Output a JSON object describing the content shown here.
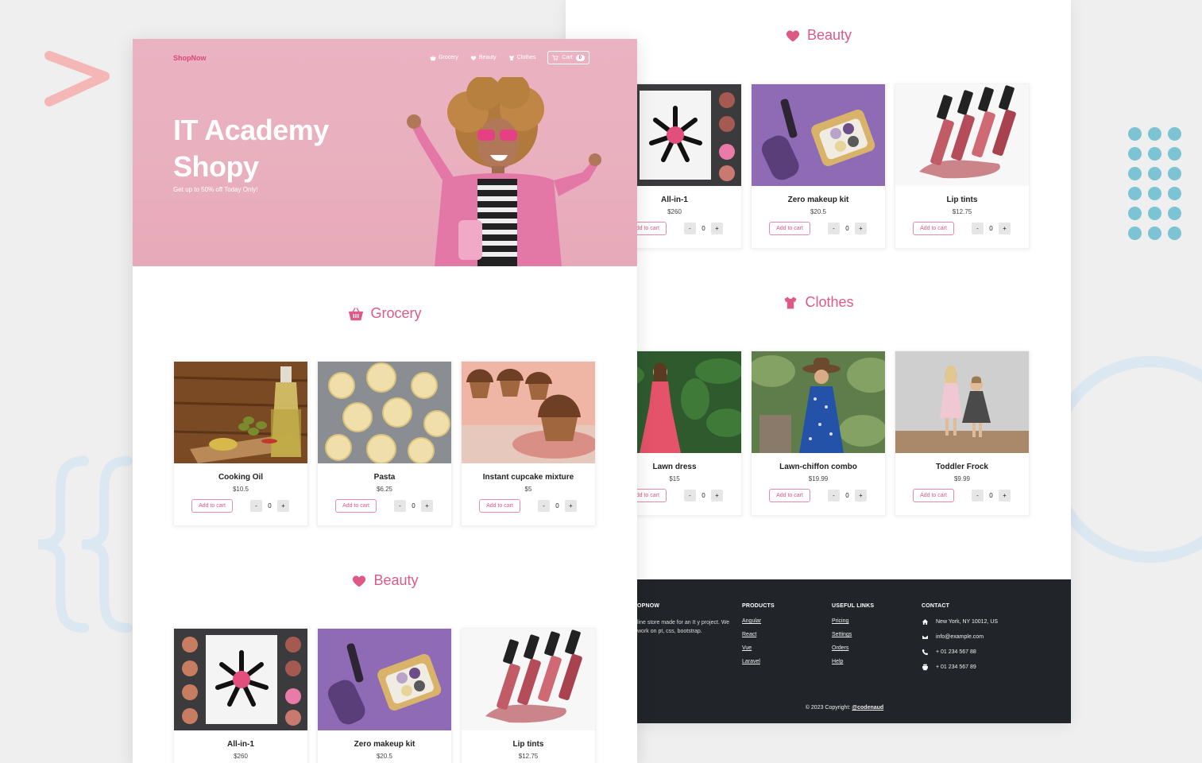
{
  "brand": "ShopNow",
  "nav": {
    "links": [
      {
        "label": "Grocery",
        "icon": "basket-icon"
      },
      {
        "label": "Beauty",
        "icon": "heart-icon"
      },
      {
        "label": "Clothes",
        "icon": "shirt-icon"
      }
    ],
    "cart_label": "Cart",
    "cart_count": "0"
  },
  "hero": {
    "title_line1": "IT Academy",
    "title_line2": "Shopy",
    "tagline": "Get up to 50% off Today Only!"
  },
  "add_to_cart_label": "Add to cart",
  "sections": {
    "grocery": {
      "title": "Grocery",
      "products": [
        {
          "name": "Cooking Oil",
          "price": "$10.5",
          "qty": "0"
        },
        {
          "name": "Pasta",
          "price": "$6.25",
          "qty": "0"
        },
        {
          "name": "Instant cupcake mixture",
          "price": "$5",
          "qty": "0"
        }
      ]
    },
    "beauty": {
      "title": "Beauty",
      "products": [
        {
          "name": "All-in-1",
          "price": "$260",
          "qty": "0"
        },
        {
          "name": "Zero makeup kit",
          "price": "$20.5",
          "qty": "0"
        },
        {
          "name": "Lip tints",
          "price": "$12.75",
          "qty": "0"
        }
      ]
    },
    "clothes": {
      "title": "Clothes",
      "products": [
        {
          "name": "Lawn dress",
          "price": "$15",
          "qty": "0"
        },
        {
          "name": "Lawn-chiffon combo",
          "price": "$19.99",
          "qty": "0"
        },
        {
          "name": "Toddler Frock",
          "price": "$9.99",
          "qty": "0"
        }
      ]
    }
  },
  "footer": {
    "about_title": "OPNOW",
    "about_text": "line store made for an It y project. We work on pt, css, bootstrap.",
    "products_title": "PRODUCTS",
    "products_links": [
      "Angular",
      "React",
      "Vue",
      "Laravel"
    ],
    "useful_title": "USEFUL LINKS",
    "useful_links": [
      "Pricing",
      "Settings",
      "Orders",
      "Help"
    ],
    "contact_title": "CONTACT",
    "contact": [
      {
        "text": "New York, NY 10012, US",
        "icon": "home-icon"
      },
      {
        "text": "info@example.com",
        "icon": "envelope-icon"
      },
      {
        "text": "+ 01 234 567 88",
        "icon": "phone-icon"
      },
      {
        "text": "+ 01 234 567 89",
        "icon": "printer-icon"
      }
    ],
    "copyright_prefix": "© 2023 Copyright:",
    "copyright_handle": "@codenaud"
  },
  "colors": {
    "accent": "#dd5a84",
    "hero_bg": "#eab3c2",
    "footer_bg": "#212529"
  }
}
